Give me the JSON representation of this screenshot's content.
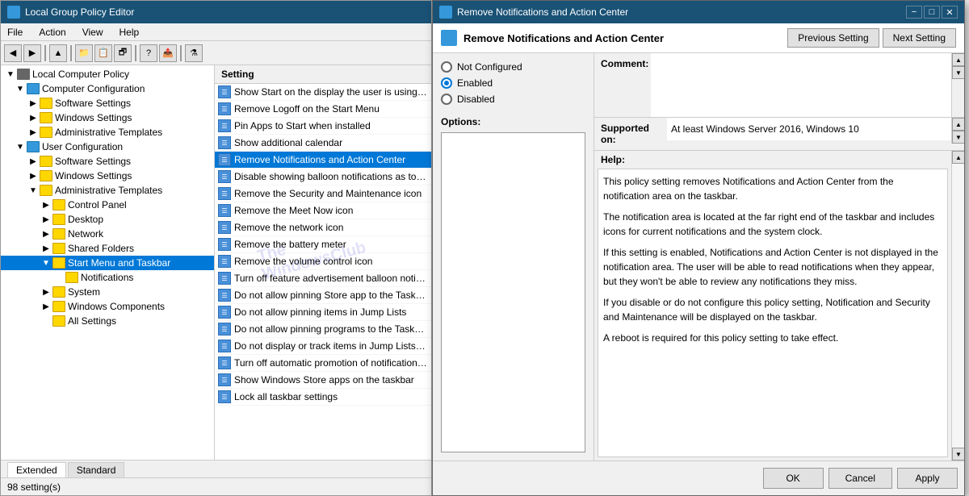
{
  "mainWindow": {
    "title": "Local Group Policy Editor",
    "menus": [
      "File",
      "Action",
      "View",
      "Help"
    ],
    "statusBar": "98 setting(s)",
    "tabs": [
      "Extended",
      "Standard"
    ]
  },
  "tree": {
    "root": "Local Computer Policy",
    "items": [
      {
        "id": "computer-config",
        "label": "Computer Configuration",
        "level": 1,
        "expanded": true,
        "type": "computer"
      },
      {
        "id": "software-settings",
        "label": "Software Settings",
        "level": 2,
        "type": "folder"
      },
      {
        "id": "windows-settings",
        "label": "Windows Settings",
        "level": 2,
        "type": "folder"
      },
      {
        "id": "admin-templates-1",
        "label": "Administrative Templates",
        "level": 2,
        "type": "folder"
      },
      {
        "id": "user-config",
        "label": "User Configuration",
        "level": 1,
        "expanded": true,
        "type": "computer"
      },
      {
        "id": "software-settings-2",
        "label": "Software Settings",
        "level": 2,
        "type": "folder"
      },
      {
        "id": "windows-settings-2",
        "label": "Windows Settings",
        "level": 2,
        "type": "folder"
      },
      {
        "id": "admin-templates-2",
        "label": "Administrative Templates",
        "level": 2,
        "expanded": true,
        "type": "folder"
      },
      {
        "id": "control-panel",
        "label": "Control Panel",
        "level": 3,
        "type": "folder"
      },
      {
        "id": "desktop",
        "label": "Desktop",
        "level": 3,
        "type": "folder"
      },
      {
        "id": "network",
        "label": "Network",
        "level": 3,
        "type": "folder"
      },
      {
        "id": "shared-folders",
        "label": "Shared Folders",
        "level": 3,
        "type": "folder"
      },
      {
        "id": "start-menu-taskbar",
        "label": "Start Menu and Taskbar",
        "level": 3,
        "expanded": true,
        "type": "folder",
        "selected": true
      },
      {
        "id": "notifications",
        "label": "Notifications",
        "level": 4,
        "type": "folder"
      },
      {
        "id": "system",
        "label": "System",
        "level": 3,
        "type": "folder"
      },
      {
        "id": "windows-components",
        "label": "Windows Components",
        "level": 3,
        "type": "folder"
      },
      {
        "id": "all-settings",
        "label": "All Settings",
        "level": 3,
        "type": "folder"
      }
    ]
  },
  "listPanel": {
    "header": "Setting",
    "items": [
      {
        "id": 1,
        "text": "Show Start on the display the user is using when t"
      },
      {
        "id": 2,
        "text": "Remove Logoff on the Start Menu"
      },
      {
        "id": 3,
        "text": "Pin Apps to Start when installed"
      },
      {
        "id": 4,
        "text": "Show additional calendar"
      },
      {
        "id": 5,
        "text": "Remove Notifications and Action Center",
        "selected": true
      },
      {
        "id": 6,
        "text": "Disable showing balloon notifications as toasts."
      },
      {
        "id": 7,
        "text": "Remove the Security and Maintenance icon"
      },
      {
        "id": 8,
        "text": "Remove the Meet Now icon"
      },
      {
        "id": 9,
        "text": "Remove the network icon"
      },
      {
        "id": 10,
        "text": "Remove the battery meter"
      },
      {
        "id": 11,
        "text": "Remove the volume control icon"
      },
      {
        "id": 12,
        "text": "Turn off feature advertisement balloon notificatio"
      },
      {
        "id": 13,
        "text": "Do not allow pinning Store app to the Taskbar"
      },
      {
        "id": 14,
        "text": "Do not allow pinning items in Jump Lists"
      },
      {
        "id": 15,
        "text": "Do not allow pinning programs to the Taskbar"
      },
      {
        "id": 16,
        "text": "Do not display or track items in Jump Lists from r"
      },
      {
        "id": 17,
        "text": "Turn off automatic promotion of notification ico"
      },
      {
        "id": 18,
        "text": "Show Windows Store apps on the taskbar"
      },
      {
        "id": 19,
        "text": "Lock all taskbar settings"
      }
    ]
  },
  "dialog": {
    "title": "Remove Notifications and Action Center",
    "headerTitle": "Remove Notifications and Action Center",
    "prevBtn": "Previous Setting",
    "nextBtn": "Next Setting",
    "commentLabel": "Comment:",
    "supportedLabel": "Supported on:",
    "supportedValue": "At least Windows Server 2016, Windows 10",
    "optionsLabel": "Options:",
    "helpLabel": "Help:",
    "radioOptions": [
      {
        "id": "not-configured",
        "label": "Not Configured",
        "checked": false
      },
      {
        "id": "enabled",
        "label": "Enabled",
        "checked": true
      },
      {
        "id": "disabled",
        "label": "Disabled",
        "checked": false
      }
    ],
    "helpText": [
      "This policy setting removes Notifications and Action Center from the notification area on the taskbar.",
      "The notification area is located at the far right end of the taskbar and includes icons for current notifications and the system clock.",
      "If this setting is enabled, Notifications and Action Center is not displayed in the notification area. The user will be able to read notifications when they appear, but they won't be able to review any notifications they miss.",
      "If you disable or do not configure this policy setting, Notification and Security and Maintenance will be displayed on the taskbar.",
      "A reboot is required for this policy setting to take effect."
    ],
    "buttons": {
      "ok": "OK",
      "cancel": "Cancel",
      "apply": "Apply"
    }
  },
  "watermarks": {
    "text": "WindowsClub",
    "subtext": "The"
  }
}
